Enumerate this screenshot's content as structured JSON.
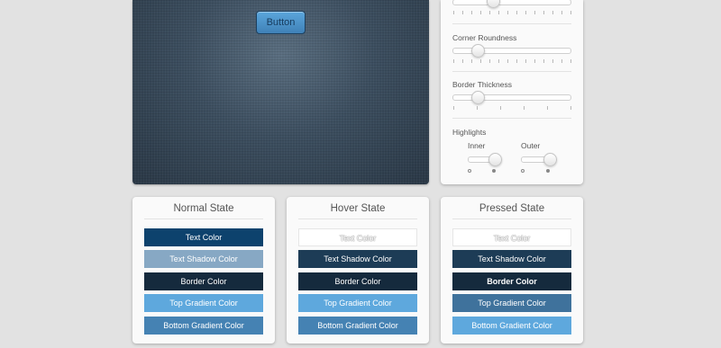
{
  "preview": {
    "button_label": "Button"
  },
  "panel": {
    "corner_label": "Corner Roundness",
    "border_label": "Border Thickness",
    "highlights_label": "Highlights",
    "inner_label": "Inner",
    "outer_label": "Outer"
  },
  "states": [
    {
      "title": "Normal State",
      "swatches": [
        {
          "label": "Text Color",
          "bg": "#0d426d",
          "fg": "#ffffff"
        },
        {
          "label": "Text Shadow Color",
          "bg": "#87a8c4",
          "fg": "#ffffff"
        },
        {
          "label": "Border Color",
          "bg": "#152a3d",
          "fg": "#ffffff"
        },
        {
          "label": "Top Gradient Color",
          "bg": "#5ea8dd",
          "fg": "#ffffff"
        },
        {
          "label": "Bottom Gradient Color",
          "bg": "#4582b3",
          "fg": "#ffffff"
        }
      ]
    },
    {
      "title": "Hover State",
      "swatches": [
        {
          "label": "Text Color",
          "bg": "#ffffff",
          "fg": "#ffffff"
        },
        {
          "label": "Text Shadow Color",
          "bg": "#1d3c56",
          "fg": "#ffffff"
        },
        {
          "label": "Border Color",
          "bg": "#152a3d",
          "fg": "#ffffff"
        },
        {
          "label": "Top Gradient Color",
          "bg": "#5ea8dd",
          "fg": "#ffffff"
        },
        {
          "label": "Bottom Gradient Color",
          "bg": "#4582b3",
          "fg": "#ffffff"
        }
      ]
    },
    {
      "title": "Pressed State",
      "swatches": [
        {
          "label": "Text Color",
          "bg": "#ffffff",
          "fg": "#ffffff"
        },
        {
          "label": "Text Shadow Color",
          "bg": "#1d3c56",
          "fg": "#ffffff"
        },
        {
          "label": "Border Color",
          "bg": "#152a3d",
          "fg": "#ffffff"
        },
        {
          "label": "Top Gradient Color",
          "bg": "#3f729c",
          "fg": "#ffffff"
        },
        {
          "label": "Bottom Gradient Color",
          "bg": "#5ea8dd",
          "fg": "#ffffff"
        }
      ]
    }
  ]
}
